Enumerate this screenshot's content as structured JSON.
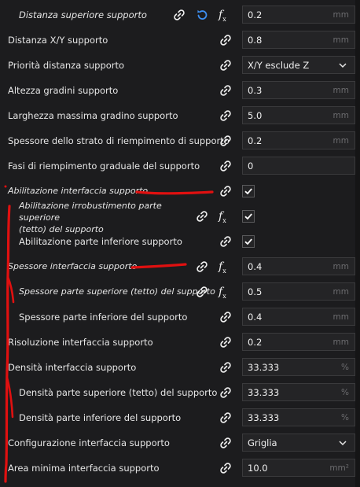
{
  "settings": [
    {
      "label": "Distanza superiore supporto",
      "italic": true,
      "indent": true,
      "reset": true,
      "fx": true,
      "control": "field",
      "value": "0.2",
      "unit": "mm"
    },
    {
      "label": "Distanza X/Y supporto",
      "control": "field",
      "value": "0.8",
      "unit": "mm"
    },
    {
      "label": "Priorità distanza supporto",
      "control": "dropdown",
      "value": "X/Y esclude Z"
    },
    {
      "label": "Altezza gradini supporto",
      "control": "field",
      "value": "0.3",
      "unit": "mm"
    },
    {
      "label": "Larghezza massima gradino supporto",
      "control": "field",
      "value": "5.0",
      "unit": "mm"
    },
    {
      "label": "Spessore dello strato di riempimento di supporto",
      "control": "field",
      "value": "0.2",
      "unit": "mm"
    },
    {
      "label": "Fasi di riempimento graduale del supporto",
      "control": "field",
      "value": "0",
      "unit": ""
    },
    {
      "label": "Abilitazione interfaccia supporto",
      "italic": true,
      "control": "checkbox",
      "checked": true
    },
    {
      "label_line1": "Abilitazione irrobustimento parte superiore",
      "label_line2": "(tetto) del supporto",
      "italic": true,
      "indent": true,
      "fx": true,
      "control": "checkbox",
      "checked": true
    },
    {
      "label": "Abilitazione parte inferiore supporto",
      "indent": true,
      "control": "checkbox",
      "checked": true
    },
    {
      "label": "Spessore interfaccia supporto",
      "italic": true,
      "fx": true,
      "control": "field",
      "value": "0.4",
      "unit": "mm"
    },
    {
      "label": "Spessore parte superiore (tetto) del supporto",
      "italic": true,
      "indent": true,
      "fx": true,
      "control": "field",
      "value": "0.5",
      "unit": "mm"
    },
    {
      "label": "Spessore parte inferiore del supporto",
      "indent": true,
      "control": "field",
      "value": "0.4",
      "unit": "mm"
    },
    {
      "label": "Risoluzione interfaccia supporto",
      "control": "field",
      "value": "0.2",
      "unit": "mm"
    },
    {
      "label": "Densità interfaccia supporto",
      "control": "field",
      "value": "33.333",
      "unit": "%"
    },
    {
      "label": "Densità parte superiore (tetto) del supporto",
      "indent": true,
      "control": "field",
      "value": "33.333",
      "unit": "%"
    },
    {
      "label": "Densità parte inferiore del supporto",
      "indent": true,
      "control": "field",
      "value": "33.333",
      "unit": "%"
    },
    {
      "label": "Configurazione interfaccia supporto",
      "control": "dropdown",
      "value": "Griglia"
    },
    {
      "label": "Area minima interfaccia supporto",
      "control": "field",
      "value": "10.0",
      "unit": "mm²"
    }
  ],
  "colors": {
    "background": "#1c1c1e",
    "field": "#242426",
    "annotation": "#e01010",
    "reset_icon": "#3d8ef0"
  }
}
